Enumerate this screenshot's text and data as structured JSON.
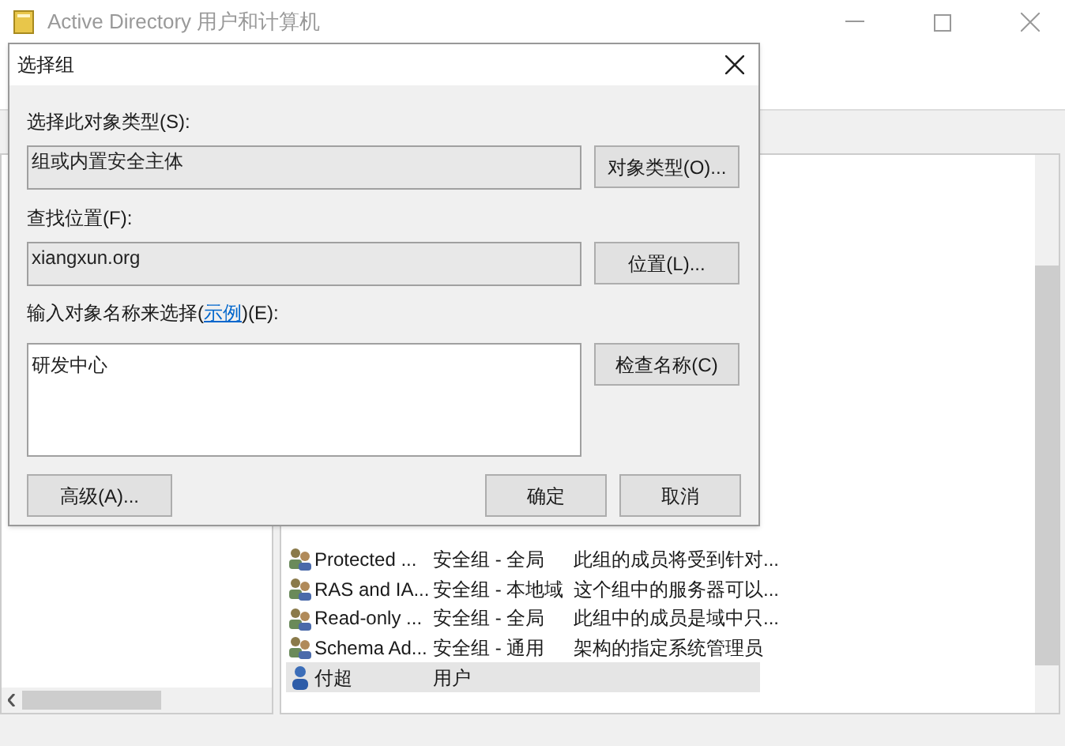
{
  "window": {
    "title": "Active Directory 用户和计算机"
  },
  "list_rows": [
    {
      "kind": "group",
      "name": "Protected ...",
      "type": "安全组 - 全局",
      "description": "此组的成员将受到针对...",
      "selected": false
    },
    {
      "kind": "group",
      "name": "RAS and IA...",
      "type": "安全组 - 本地域",
      "description": "这个组中的服务器可以...",
      "selected": false
    },
    {
      "kind": "group",
      "name": "Read-only ...",
      "type": "安全组 - 全局",
      "description": "此组中的成员是域中只...",
      "selected": false
    },
    {
      "kind": "group",
      "name": "Schema Ad...",
      "type": "安全组 - 通用",
      "description": "架构的指定系统管理员",
      "selected": false
    },
    {
      "kind": "user",
      "name": "付超",
      "type": "用户",
      "selected": true
    }
  ],
  "dialog": {
    "title": "选择组",
    "object_type": {
      "label": "选择此对象类型(S):",
      "value": "组或内置安全主体",
      "button": "对象类型(O)..."
    },
    "location": {
      "label": "查找位置(F):",
      "value": "xiangxun.org",
      "button": "位置(L)..."
    },
    "names": {
      "label_before": "输入对象名称来选择(",
      "link": "示例",
      "label_after": ")(E):",
      "value": "研发中心",
      "button": "检查名称(C)"
    },
    "advanced_button": "高级(A)...",
    "ok_button": "确定",
    "cancel_button": "取消"
  }
}
